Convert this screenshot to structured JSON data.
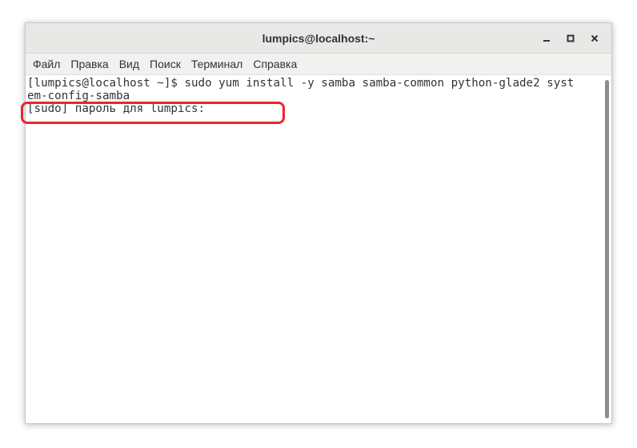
{
  "window": {
    "title": "lumpics@localhost:~"
  },
  "window_controls": [
    {
      "name": "minimize",
      "icon": "minimize-icon"
    },
    {
      "name": "maximize",
      "icon": "maximize-icon"
    },
    {
      "name": "close",
      "icon": "close-icon"
    }
  ],
  "menu": {
    "items": [
      "Файл",
      "Правка",
      "Вид",
      "Поиск",
      "Терминал",
      "Справка"
    ]
  },
  "terminal": {
    "lines": [
      "[lumpics@localhost ~]$ sudo yum install -y samba samba-common python-glade2 syst",
      "em-config-samba",
      "[sudo] пароль для lumpics: "
    ]
  },
  "colors": {
    "highlight": "#e8262b",
    "titlebar": "#e8e8e7",
    "menubar": "#f1f1f0",
    "text": "#2e3436"
  }
}
